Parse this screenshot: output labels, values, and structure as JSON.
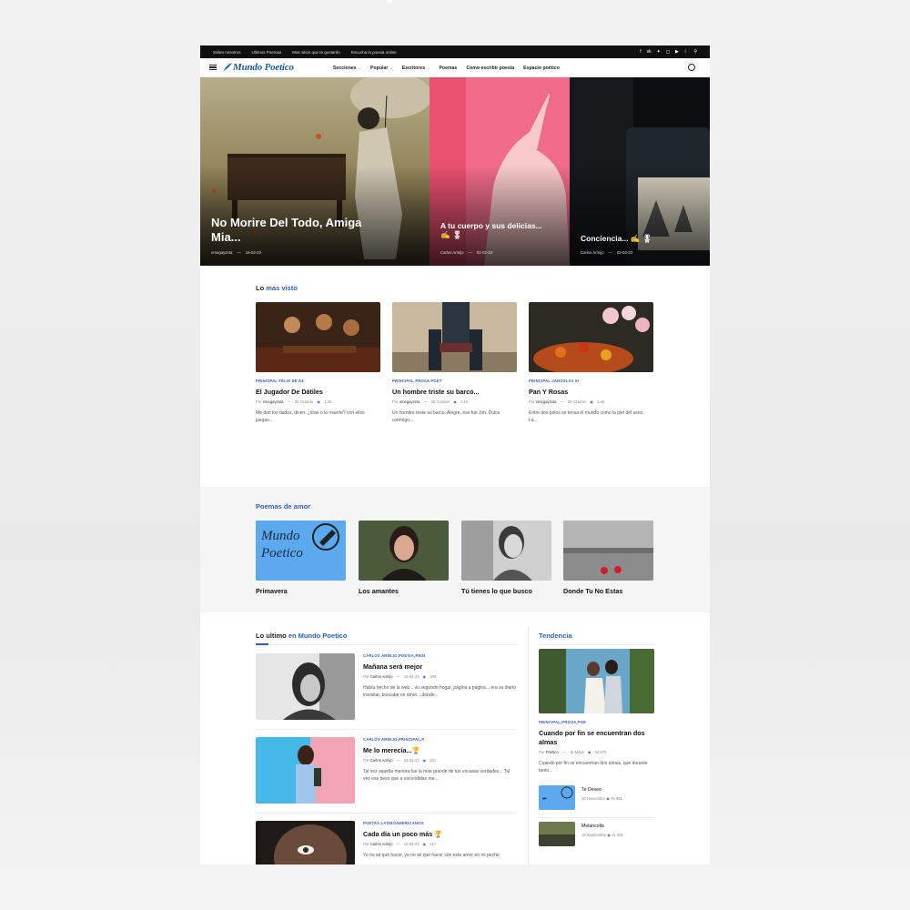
{
  "topbar": {
    "links": [
      "Sobre nosotros",
      "Ultimos Poemas",
      "Mas sitios que te gustarán",
      "Escucha la poesia online"
    ],
    "icons": [
      "facebook-icon",
      "vk-icon",
      "twitter-icon",
      "instagram-icon",
      "youtube-icon",
      "moon-icon",
      "search-icon"
    ]
  },
  "nav": {
    "logo": "Mundo Poetico",
    "items": [
      {
        "label": "Secciones",
        "dropdown": true
      },
      {
        "label": "Popular",
        "dropdown": true
      },
      {
        "label": "Escritores",
        "dropdown": true
      },
      {
        "label": "Poemas",
        "dropdown": false
      },
      {
        "label": "Como escribir poesia",
        "dropdown": false
      },
      {
        "label": "Espacio poético",
        "dropdown": false
      }
    ]
  },
  "hero": [
    {
      "title": "No Morire Del Todo, Amiga Mia...",
      "author": "omegayzeta",
      "date": "16-02-23"
    },
    {
      "title": "A tu cuerpo y sus delicias... ✍ 🎖",
      "author": "Carlos Armijo",
      "date": "02-02-23"
    },
    {
      "title": "Conciencia... ✍ 🎖",
      "author": "Carlos Armijo",
      "date": "02-02-23"
    }
  ],
  "mas_visto": {
    "title_plain": "Lo ",
    "title_accent": "mas visto",
    "posts": [
      {
        "cat": "PRINCIPAL FÉLIX DE AZ",
        "title": "El Jugador De Dátiles",
        "author": "omegayzeta",
        "date": "29 Octubre",
        "views": "1.3K",
        "excerpt": "Me dan los dados, dicen: ¿tiras o la muerte? con ellos juegas..."
      },
      {
        "cat": "PRINCIPAL PROSA POET",
        "title": "Un hombre triste su barco...",
        "author": "omegayzeta",
        "date": "29 Octubre",
        "views": "3.1K",
        "excerpt": "Un hombre triste su barco. Alegre, ése fue Jim. Dulce conmigo..."
      },
      {
        "cat": "PRINCIPAL JAROSLAV SI",
        "title": "Pan Y Rosas",
        "author": "omegayzeta",
        "date": "29 Octubre",
        "views": "1.5K",
        "excerpt": "Entre dos polos se tensa el mundo como la piel del asno. La..."
      }
    ]
  },
  "amor": {
    "title": "Poemas de amor",
    "posts": [
      {
        "title": "Primavera",
        "logo_text": "Mundo Poetico"
      },
      {
        "title": "Los amantes"
      },
      {
        "title": "Tú tienes lo que busco"
      },
      {
        "title": "Donde Tu No Estas"
      }
    ]
  },
  "latest": {
    "title_plain": "Lo ultimo ",
    "title_accent": "en Mundo Poetico",
    "posts": [
      {
        "cat": "CARLOS ARMIJO,POESIA,PRIN",
        "title": "Mañana será mejor",
        "author": "Carlos Armijo",
        "date": "16-01-23",
        "views": "190",
        "excerpt": "Había hecho de la web... su segundo hogar, página a página... era su diario transitar, buscaba un amor....donde..."
      },
      {
        "cat": "CARLOS ARMIJO,PRINCIPAL,P",
        "title": "Me lo merecía...🏆",
        "author": "Carlos Armijo",
        "date": "16-01-23",
        "views": "201",
        "excerpt": "Tal vez aquella mentira fue la más grande de tus escasas verdades... Tal vez ese beso que a escondidas me..."
      },
      {
        "cat": "POETAS LATINOAMERICANOS",
        "title": "Cada día un poco más 🏆",
        "author": "Carlos Armijo",
        "date": "16-01-23",
        "views": "217",
        "excerpt": "Yo no sé qué hacer, yo no sé qué hacer con este amor en mi pecho"
      }
    ]
  },
  "trending": {
    "title": "Tendencia",
    "main": {
      "cat": "PRINCIPAL,PROSA,POE",
      "title": "Cuando por fin se encuentran dos almas",
      "author": "Poetico",
      "date": "18 Mayo",
      "views": "54 579",
      "excerpt": "Cuando por fin se encuentran dos almas, que durante tanto..."
    },
    "small": [
      {
        "title": "Te Deseo",
        "date": "20 Noviembre",
        "views": "29 851"
      },
      {
        "title": "Melancolia",
        "date": "18 Septiembre",
        "views": "11 425"
      }
    ]
  },
  "colors": {
    "accent": "#2f5fbf",
    "topbar": "#101010",
    "logo": "#1a5fa0"
  }
}
